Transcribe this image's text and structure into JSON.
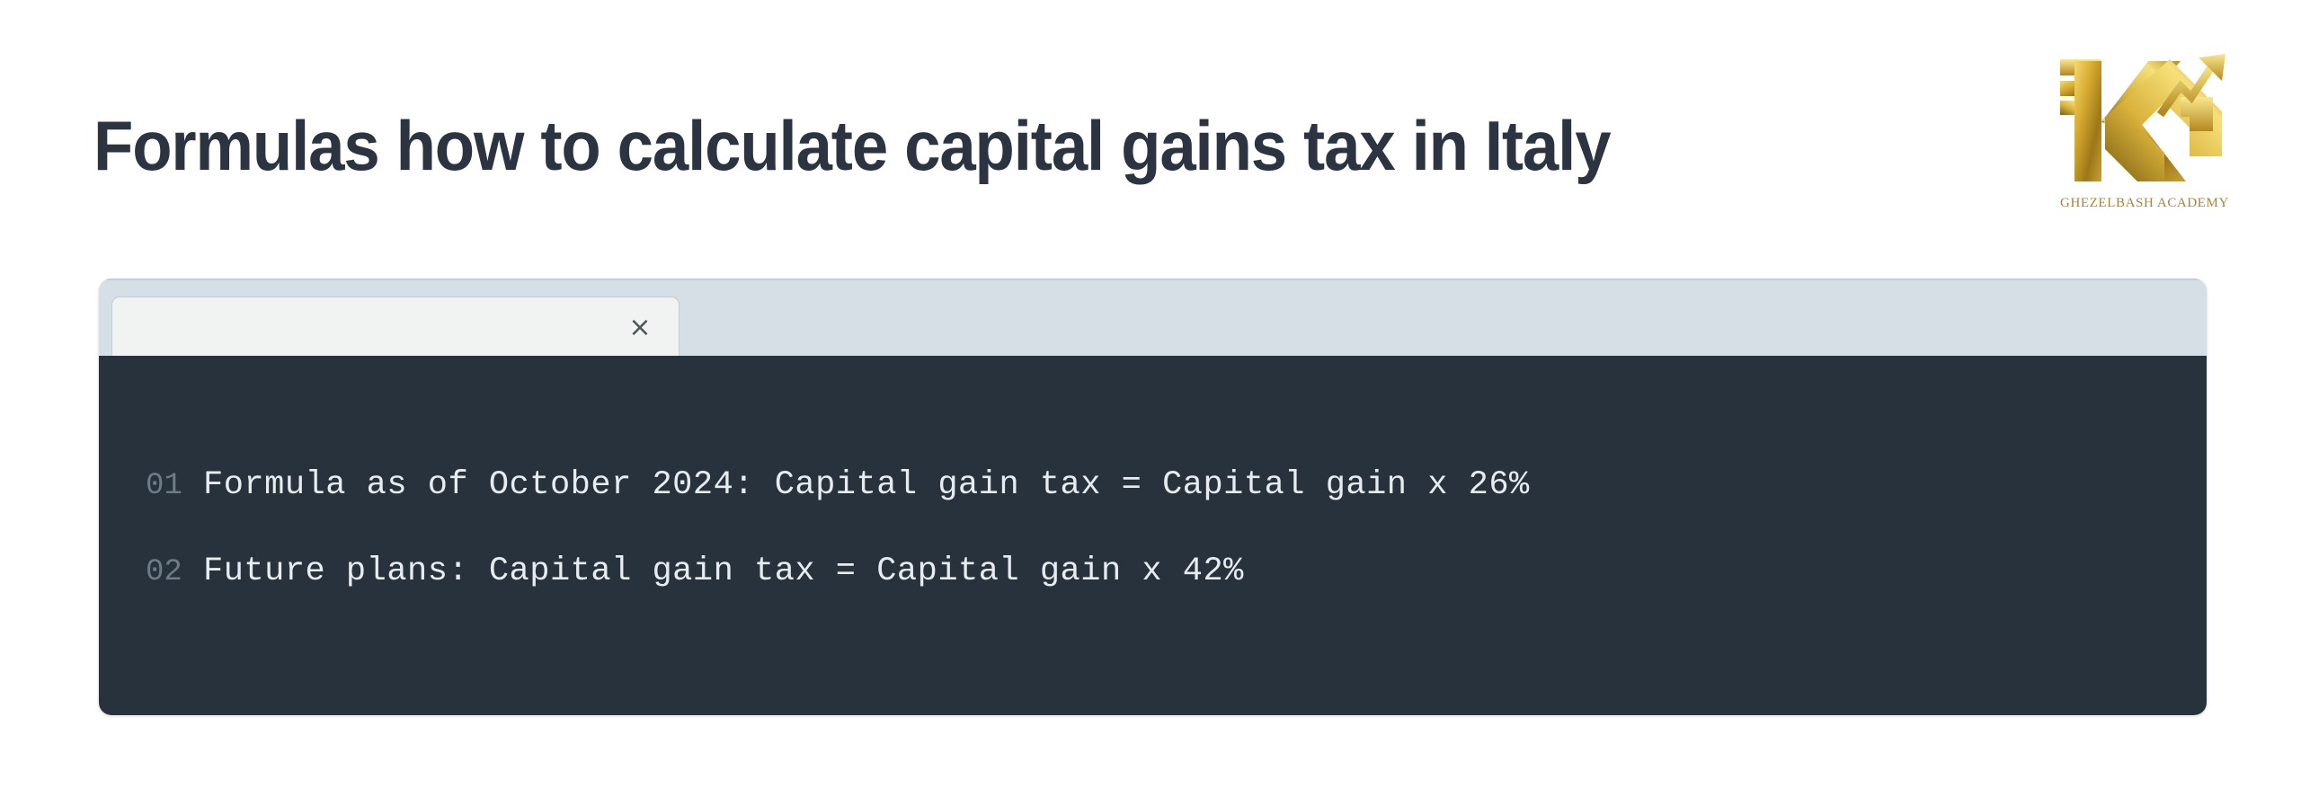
{
  "page": {
    "background_color": "#ffffff",
    "title": "Formulas how to calculate capital gains tax in Italy"
  },
  "header": {
    "title": "Formulas how to calculate capital gains tax in Italy",
    "title_color": "#2b3440"
  },
  "logo": {
    "mark_name": "kg-monogram-with-growth-arrow",
    "text": "GHEZELBASH  ACADEMY",
    "gold_light": "#f2cf5b",
    "gold_mid": "#c79b2a",
    "gold_dark": "#8a6a14",
    "text_color": "#a8833a"
  },
  "code_card": {
    "header_color": "#d6dfe5",
    "body_color": "#28323c",
    "tab": {
      "label": "",
      "close_icon": "×",
      "background": "#f1f3f3"
    },
    "lines": [
      {
        "number": "01",
        "text": "Formula as of October 2024: Capital gain tax = Capital gain x 26%"
      },
      {
        "number": "02",
        "text": "Future plans: Capital gain tax = Capital gain x 42%"
      }
    ],
    "line_number_color": "#6e7c88",
    "code_text_color": "#e6ecef"
  }
}
